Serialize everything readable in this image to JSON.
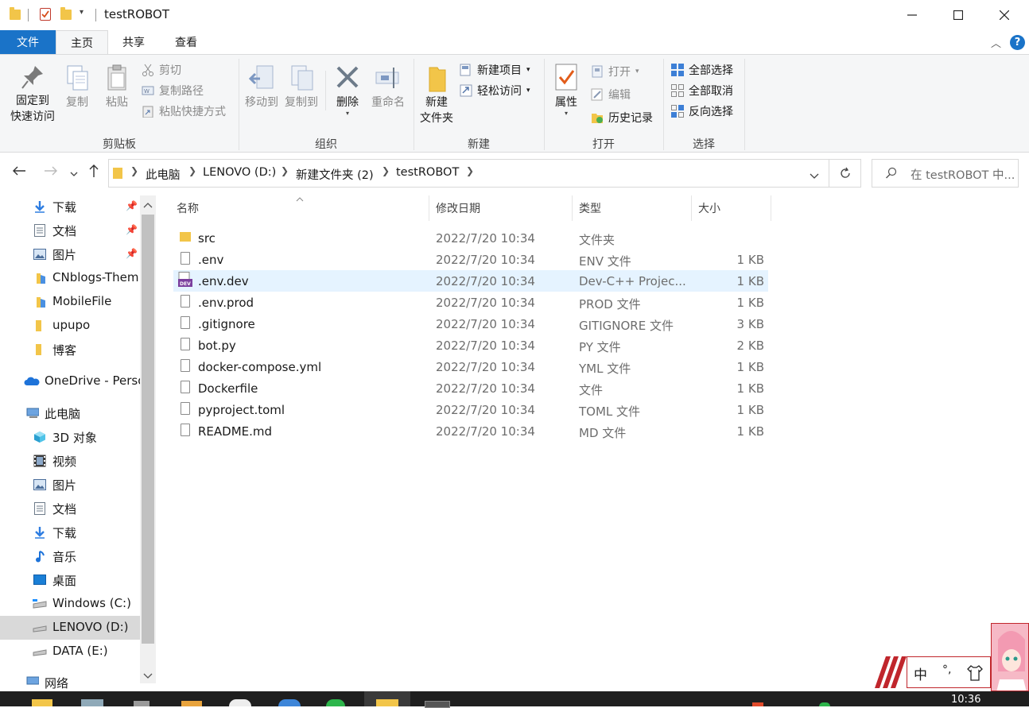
{
  "window": {
    "title": "testROBOT"
  },
  "ribbon_tabs": {
    "file": "文件",
    "home": "主页",
    "share": "共享",
    "view": "查看"
  },
  "clipboard": {
    "pin_line1": "固定到",
    "pin_line2": "快速访问",
    "copy": "复制",
    "paste": "粘贴",
    "cut": "剪切",
    "copy_path": "复制路径",
    "paste_shortcut": "粘贴快捷方式",
    "label": "剪贴板"
  },
  "organize": {
    "move_to": "移动到",
    "copy_to": "复制到",
    "delete": "删除",
    "rename": "重命名",
    "label": "组织"
  },
  "new": {
    "new_folder_line1": "新建",
    "new_folder_line2": "文件夹",
    "new_item": "新建项目",
    "easy_access": "轻松访问",
    "label": "新建"
  },
  "open": {
    "properties": "属性",
    "open": "打开",
    "edit": "编辑",
    "history": "历史记录",
    "label": "打开"
  },
  "select": {
    "select_all": "全部选择",
    "select_none": "全部取消",
    "invert": "反向选择",
    "label": "选择"
  },
  "address": {
    "crumbs": [
      "此电脑",
      "LENOVO (D:)",
      "新建文件夹 (2)",
      "testROBOT"
    ],
    "search_placeholder": "在 testROBOT 中..."
  },
  "nav_pane": {
    "items": [
      {
        "label": "下载",
        "icon": "download-icon",
        "pinned": true
      },
      {
        "label": "文档",
        "icon": "document-icon",
        "pinned": true
      },
      {
        "label": "图片",
        "icon": "picture-icon",
        "pinned": true
      },
      {
        "label": "CNblogs-Them",
        "icon": "folder-icon",
        "pinned": false
      },
      {
        "label": "MobileFile",
        "icon": "folder-icon",
        "pinned": false
      },
      {
        "label": "upupo",
        "icon": "folder-icon",
        "pinned": false
      },
      {
        "label": "博客",
        "icon": "folder-icon",
        "pinned": false
      },
      {
        "label": "OneDrive - Perso",
        "icon": "cloud-icon",
        "pinned": false
      },
      {
        "label": "此电脑",
        "icon": "computer-icon",
        "pinned": false
      },
      {
        "label": "3D 对象",
        "icon": "cube-icon",
        "pinned": false
      },
      {
        "label": "视频",
        "icon": "video-icon",
        "pinned": false
      },
      {
        "label": "图片",
        "icon": "picture-icon",
        "pinned": false
      },
      {
        "label": "文档",
        "icon": "document-icon",
        "pinned": false
      },
      {
        "label": "下载",
        "icon": "download-icon",
        "pinned": false
      },
      {
        "label": "音乐",
        "icon": "music-icon",
        "pinned": false
      },
      {
        "label": "桌面",
        "icon": "desktop-icon",
        "pinned": false
      },
      {
        "label": "Windows (C:)",
        "icon": "drive-icon",
        "pinned": false
      },
      {
        "label": "LENOVO (D:)",
        "icon": "drive-icon",
        "pinned": false,
        "selected": true
      },
      {
        "label": "DATA (E:)",
        "icon": "drive-icon",
        "pinned": false
      },
      {
        "label": "网络",
        "icon": "network-icon",
        "pinned": false
      }
    ]
  },
  "columns": {
    "name": "名称",
    "date": "修改日期",
    "type": "类型",
    "size": "大小"
  },
  "files": [
    {
      "name": "src",
      "date": "2022/7/20 10:34",
      "type": "文件夹",
      "size": "",
      "icon": "folder-icon"
    },
    {
      "name": ".env",
      "date": "2022/7/20 10:34",
      "type": "ENV 文件",
      "size": "1 KB",
      "icon": "file-icon"
    },
    {
      "name": ".env.dev",
      "date": "2022/7/20 10:34",
      "type": "Dev-C++ Projec...",
      "size": "1 KB",
      "icon": "devcpp-icon",
      "selected": true
    },
    {
      "name": ".env.prod",
      "date": "2022/7/20 10:34",
      "type": "PROD 文件",
      "size": "1 KB",
      "icon": "file-icon"
    },
    {
      "name": ".gitignore",
      "date": "2022/7/20 10:34",
      "type": "GITIGNORE 文件",
      "size": "3 KB",
      "icon": "file-icon"
    },
    {
      "name": "bot.py",
      "date": "2022/7/20 10:34",
      "type": "PY 文件",
      "size": "2 KB",
      "icon": "file-icon"
    },
    {
      "name": "docker-compose.yml",
      "date": "2022/7/20 10:34",
      "type": "YML 文件",
      "size": "1 KB",
      "icon": "file-icon"
    },
    {
      "name": "Dockerfile",
      "date": "2022/7/20 10:34",
      "type": "文件",
      "size": "1 KB",
      "icon": "file-icon"
    },
    {
      "name": "pyproject.toml",
      "date": "2022/7/20 10:34",
      "type": "TOML 文件",
      "size": "1 KB",
      "icon": "file-icon"
    },
    {
      "name": "README.md",
      "date": "2022/7/20 10:34",
      "type": "MD 文件",
      "size": "1 KB",
      "icon": "file-icon"
    }
  ],
  "taskbar": {
    "clock": "10:36"
  },
  "ime": {
    "mode": "中"
  },
  "colors": {
    "accent": "#1a73c8",
    "selection": "#e5f3ff",
    "folder": "#f2c549"
  }
}
